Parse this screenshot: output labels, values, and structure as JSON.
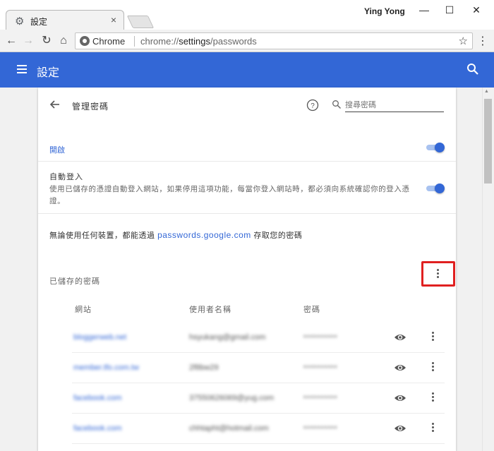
{
  "window": {
    "tab_title": "設定",
    "profile_name": "Ying Yong",
    "minimize": "—",
    "maximize": "☐",
    "close": "✕",
    "tab_close": "×"
  },
  "toolbar": {
    "origin_chip": "Chrome",
    "url_prefix": "chrome://",
    "url_path_bold": "settings",
    "url_rest": "/passwords"
  },
  "header": {
    "title": "設定"
  },
  "subpage": {
    "title": "管理密碼",
    "search_placeholder": "搜尋密碼"
  },
  "settings": {
    "enabled_label": "開啟",
    "autosignin_title": "自動登入",
    "autosignin_desc": "使用已儲存的憑證自動登入網站，如果停用這項功能，每當你登入網站時，都必須向系統確認你的登入憑證。",
    "info_prefix": "無論使用任何裝置，都能透過 ",
    "info_link": "passwords.google.com",
    "info_suffix": " 存取您的密碼"
  },
  "saved": {
    "section_title": "已儲存的密碼",
    "columns": [
      "網站",
      "使用者名稱",
      "密碼"
    ],
    "rows": [
      {
        "site": "bloggerweb.net",
        "user": "hsyukang@gmail.com",
        "password": "••••••••••"
      },
      {
        "site": "member.tfo.com.tw",
        "user": "2f8bw29",
        "password": "••••••••••"
      },
      {
        "site": "facebook.com",
        "user": "37550626069@yug.com",
        "password": "••••••••••"
      },
      {
        "site": "facebook.com",
        "user": "chhtapht@hotmail.com",
        "password": "••••••••••"
      }
    ]
  },
  "colors": {
    "accent": "#3367d6",
    "highlight": "#e02020"
  }
}
